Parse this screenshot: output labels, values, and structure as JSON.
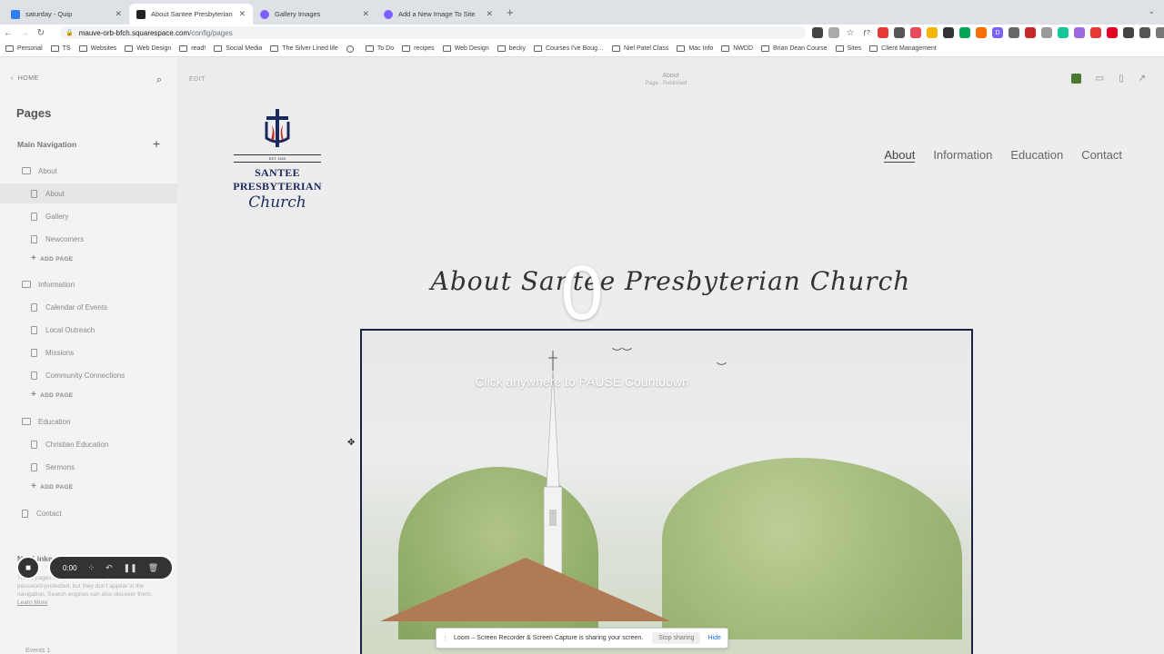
{
  "browser": {
    "tabs": [
      {
        "label": "saturday - Quip",
        "color": "#2f80ed",
        "active": false
      },
      {
        "label": "About Santee Presbyterian Ch…",
        "color": "#222222",
        "active": true
      },
      {
        "label": "Gallery Images",
        "color": "#7b61ff",
        "active": false
      },
      {
        "label": "Add a New Image To Site",
        "color": "#7b61ff",
        "active": false
      }
    ],
    "url_host": "mauve-orb-bfch.squarespace.com",
    "url_path": "/config/pages",
    "bookmarks": [
      "Personal",
      "TS",
      "Websites",
      "Web Design",
      "read!",
      "Social Media",
      "The Silver Lined life",
      "",
      "To Do",
      "recipes",
      "Web Design",
      "becky",
      "Courses I've Boug…",
      "Niel Patel Class",
      "Mac Info",
      "NWDD",
      "Brian Dean Course",
      "Sites",
      "Client Management"
    ]
  },
  "sidebar": {
    "home": "HOME",
    "title": "Pages",
    "main_nav": "Main Navigation",
    "not_linked": "Not Linked",
    "add_page": "ADD PAGE",
    "folders": {
      "about": "About",
      "information": "Information",
      "education": "Education"
    },
    "about_items": [
      "About",
      "Gallery",
      "Newcomers"
    ],
    "information_items": [
      "Calendar of Events",
      "Local Outreach",
      "Missions",
      "Community Connections"
    ],
    "education_items": [
      "Christian Education",
      "Sermons"
    ],
    "contact": "Contact",
    "note": "These pages are public unless they're disabled or password-protected, but they don't appear in the navigation. Search engines can also discover them.",
    "note_link": "Learn More",
    "events": "Events 1"
  },
  "loom": {
    "timer": "0:00",
    "share_text": "Loom – Screen Recorder & Screen Capture is sharing your screen.",
    "stop": "Stop sharing",
    "hide": "Hide"
  },
  "editor": {
    "edit": "EDIT",
    "page_name": "About",
    "page_status": "Page · Published"
  },
  "site": {
    "logo_est": "EST. 1915",
    "logo_name": "SANTEE PRESBYTERIAN",
    "logo_church": "Church",
    "nav": [
      "About",
      "Information",
      "Education",
      "Contact"
    ],
    "heading": "About Santee Presbyterian Church"
  },
  "countdown": {
    "number": "0",
    "message": "Click anywhere to PAUSE Countdown"
  }
}
